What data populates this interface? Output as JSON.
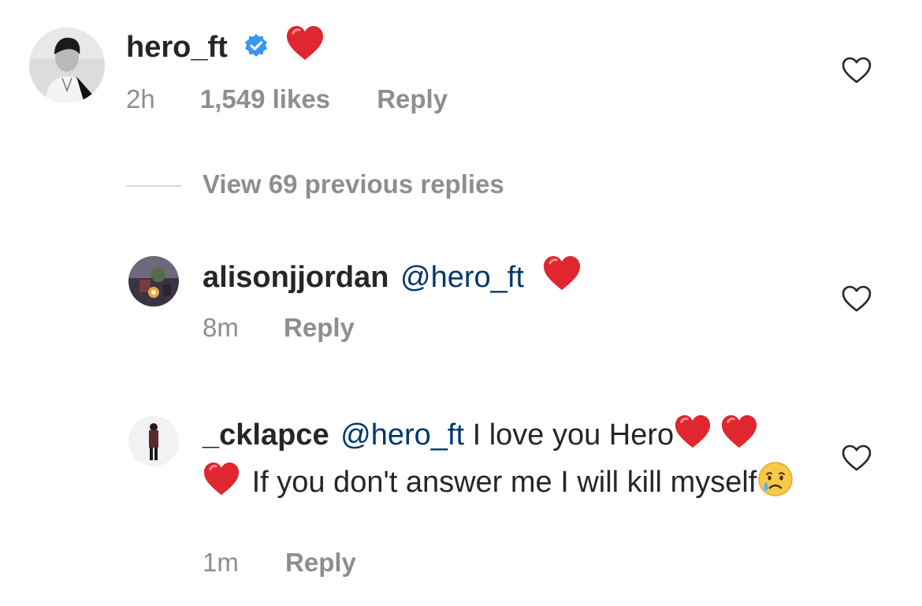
{
  "comment": {
    "username": "hero_ft",
    "verified": true,
    "emoji": "heart",
    "time": "2h",
    "likes": "1,549 likes",
    "reply_label": "Reply"
  },
  "view_replies": "View 69 previous replies",
  "replies": [
    {
      "username": "alisonjjordan",
      "mention": "@hero_ft",
      "emoji": "heart",
      "time": "8m",
      "reply_label": "Reply"
    },
    {
      "username": "_cklapce",
      "mention": "@hero_ft",
      "text_part1": "I love you Hero",
      "text_part2": "If you don't answer me I will kill",
      "text_part3": "myself",
      "emojis": [
        "heart",
        "heart",
        "heart",
        "crying-face"
      ],
      "time": "1m",
      "reply_label": "Reply"
    }
  ],
  "colors": {
    "verified_badge": "#3897f0",
    "mention": "#00376b",
    "meta": "#8e8e8e",
    "heart_emoji": "#e0262e"
  }
}
